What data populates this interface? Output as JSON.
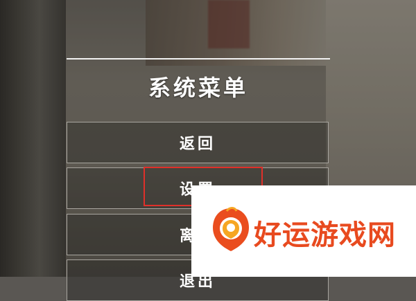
{
  "menu": {
    "title": "系统菜单",
    "buttons": [
      {
        "label": "返回"
      },
      {
        "label": "设置"
      },
      {
        "label": "离开"
      },
      {
        "label": "退出"
      }
    ]
  },
  "watermark": {
    "brand": "好运游戏网",
    "color": "#e84a1f"
  },
  "highlight_color": "#e0302a"
}
